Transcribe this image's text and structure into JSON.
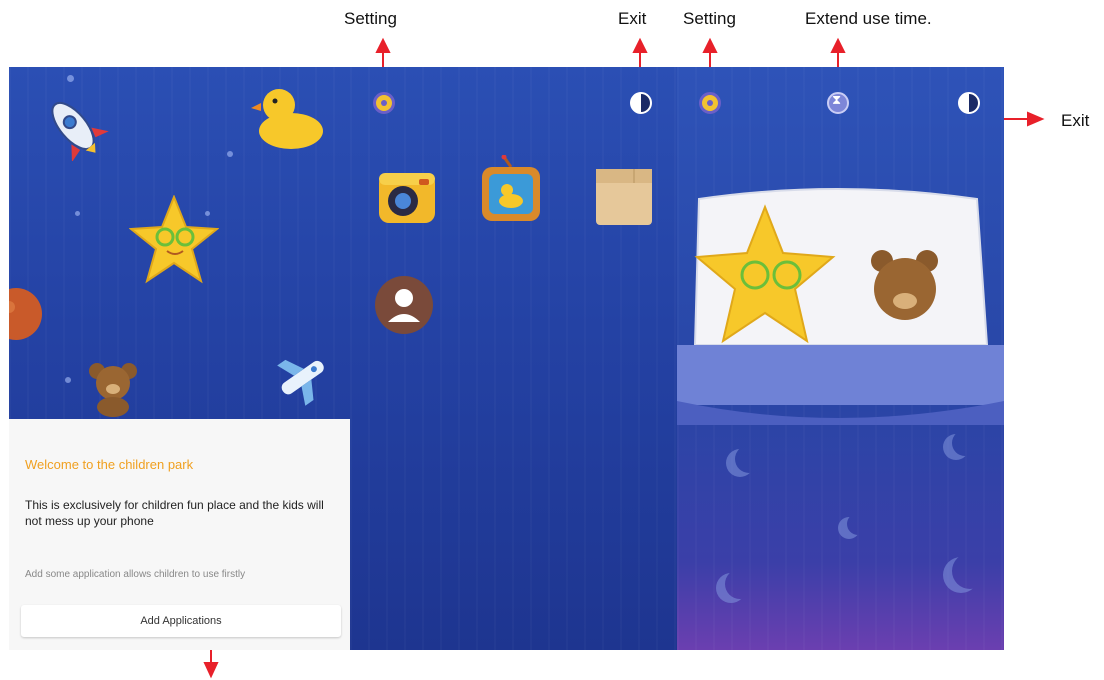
{
  "annotations": {
    "setting_left": "Setting",
    "exit_middle": "Exit",
    "setting_right": "Setting",
    "extend_use_time": "Extend use time.",
    "exit_right": "Exit"
  },
  "welcome_screen": {
    "title": "Welcome to the children park",
    "description": "This is exclusively for children fun place and the kids will not mess up your phone",
    "hint": "Add some application allows children to use firstly",
    "add_button_label": "Add Applications"
  },
  "apps_screen": {
    "apps": [
      "camera-app-icon",
      "tv-app-icon",
      "folder-app-icon",
      "contacts-app-icon"
    ]
  },
  "colors": {
    "annotation_arrow": "#e8202a",
    "title_orange": "#f0a020",
    "screen_blue": "#2442a4"
  }
}
